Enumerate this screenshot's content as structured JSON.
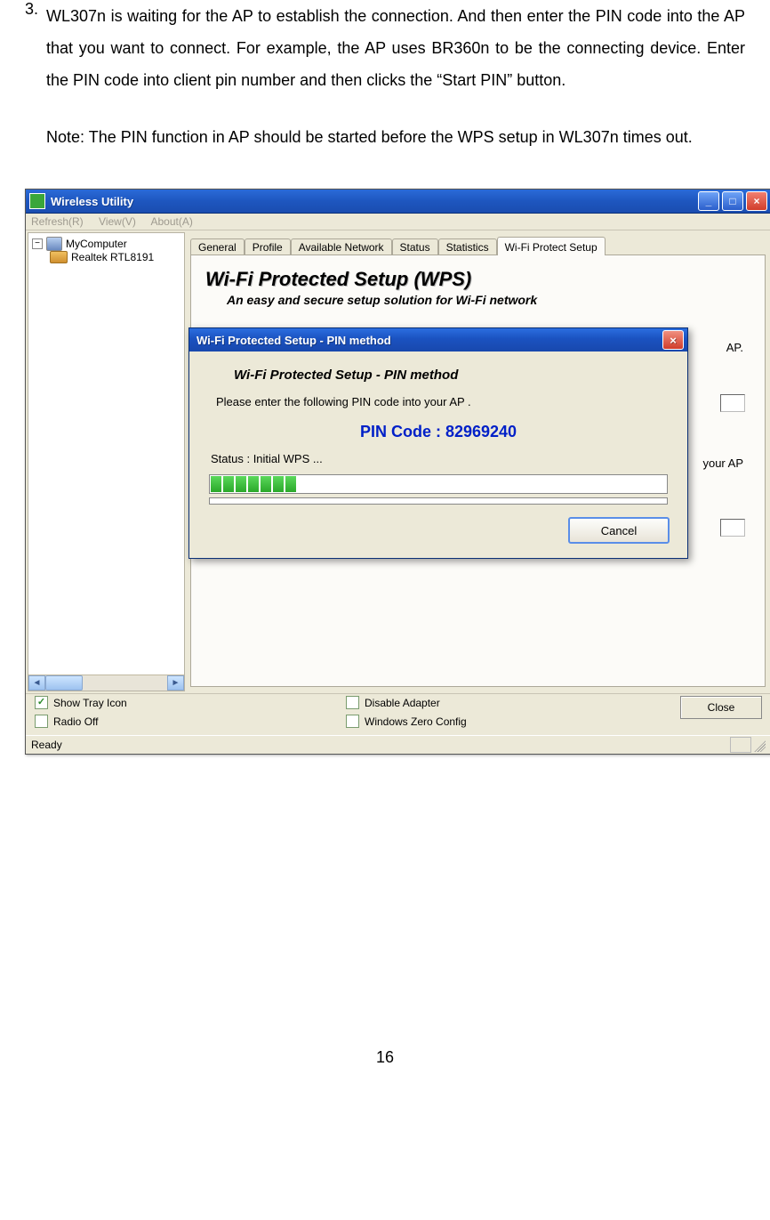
{
  "step_number": "3.",
  "step_text": "WL307n is waiting for the AP to establish the connection. And then enter the PIN code into the AP that you want to connect. For example, the AP uses BR360n to be the connecting device. Enter the PIN code into client pin number and then clicks the “Start PIN” button.",
  "note_text": "Note: The PIN function in AP should be started before the WPS setup in WL307n times out.",
  "window": {
    "title": "Wireless Utility",
    "menus": {
      "refresh": "Refresh(R)",
      "view": "View(V)",
      "about": "About(A)"
    },
    "tree": {
      "root": "MyComputer",
      "child": "Realtek RTL8191"
    },
    "tabs": {
      "general": "General",
      "profile": "Profile",
      "available": "Available Network",
      "status": "Status",
      "statistics": "Statistics",
      "wps": "Wi-Fi Protect Setup"
    },
    "panel": {
      "title": "Wi-Fi Protected Setup (WPS)",
      "subtitle": "An easy and secure setup solution for Wi-Fi network",
      "peek_ap": "AP.",
      "peek_your_ap": "your AP"
    },
    "checks": {
      "show_tray": "Show Tray Icon",
      "radio_off": "Radio Off",
      "disable_adapter": "Disable Adapter",
      "zero_config": "Windows Zero Config"
    },
    "close_btn": "Close",
    "status": "Ready"
  },
  "dialog": {
    "title": "Wi-Fi Protected Setup - PIN method",
    "heading": "Wi-Fi Protected Setup - PIN method",
    "instruction": "Please enter the following PIN code into your AP .",
    "pin_label": "PIN Code :  82969240",
    "status": "Status :  Initial WPS ...",
    "cancel": "Cancel"
  },
  "page_number": "16"
}
